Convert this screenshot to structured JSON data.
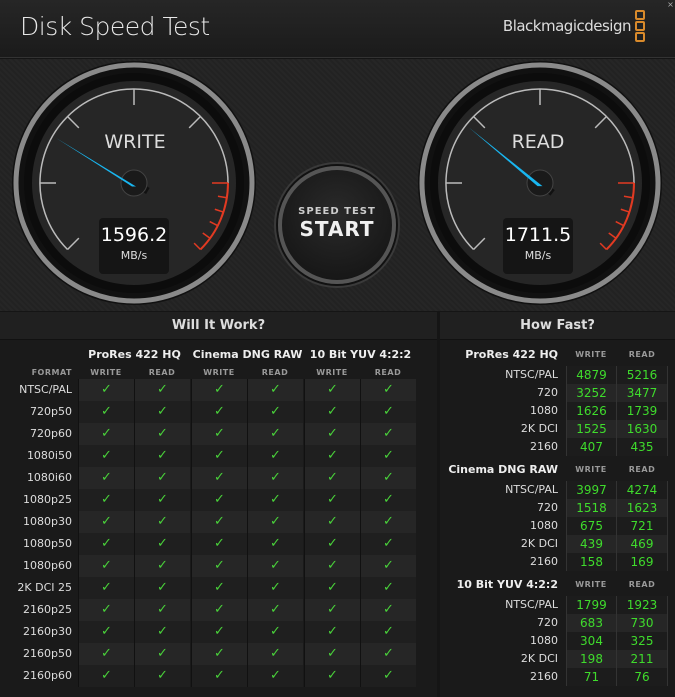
{
  "app": {
    "title": "Disk Speed Test",
    "brand": "Blackmagicdesign",
    "brand_color": "#d98a2b",
    "close": "×"
  },
  "write_gauge": {
    "label": "WRITE",
    "value": "1596.2",
    "unit": "MB/s"
  },
  "read_gauge": {
    "label": "READ",
    "value": "1711.5",
    "unit": "MB/s"
  },
  "settings": {
    "icon": "gear-icon"
  },
  "start_button": {
    "line1": "SPEED TEST",
    "line2": "START"
  },
  "will_it_work": {
    "title": "Will It Work?",
    "format_label": "FORMAT",
    "groups": [
      "ProRes 422 HQ",
      "Cinema DNG RAW",
      "10 Bit YUV 4:2:2"
    ],
    "sub": [
      "WRITE",
      "READ"
    ],
    "rows": [
      "NTSC/PAL",
      "720p50",
      "720p60",
      "1080i50",
      "1080i60",
      "1080p25",
      "1080p30",
      "1080p50",
      "1080p60",
      "2K DCI 25",
      "2160p25",
      "2160p30",
      "2160p50",
      "2160p60"
    ],
    "check": "✓",
    "check_color": "#49d23a"
  },
  "how_fast": {
    "title": "How Fast?",
    "write": "WRITE",
    "read": "READ",
    "sections": [
      {
        "name": "ProRes 422 HQ",
        "rows": [
          [
            "NTSC/PAL",
            "4879",
            "5216"
          ],
          [
            "720",
            "3252",
            "3477"
          ],
          [
            "1080",
            "1626",
            "1739"
          ],
          [
            "2K DCI",
            "1525",
            "1630"
          ],
          [
            "2160",
            "407",
            "435"
          ]
        ]
      },
      {
        "name": "Cinema DNG RAW",
        "rows": [
          [
            "NTSC/PAL",
            "3997",
            "4274"
          ],
          [
            "720",
            "1518",
            "1623"
          ],
          [
            "1080",
            "675",
            "721"
          ],
          [
            "2K DCI",
            "439",
            "469"
          ],
          [
            "2160",
            "158",
            "169"
          ]
        ]
      },
      {
        "name": "10 Bit YUV 4:2:2",
        "rows": [
          [
            "NTSC/PAL",
            "1799",
            "1923"
          ],
          [
            "720",
            "683",
            "730"
          ],
          [
            "1080",
            "304",
            "325"
          ],
          [
            "2K DCI",
            "198",
            "211"
          ],
          [
            "2160",
            "71",
            "76"
          ]
        ]
      }
    ],
    "value_color": "#3fdc2c"
  }
}
